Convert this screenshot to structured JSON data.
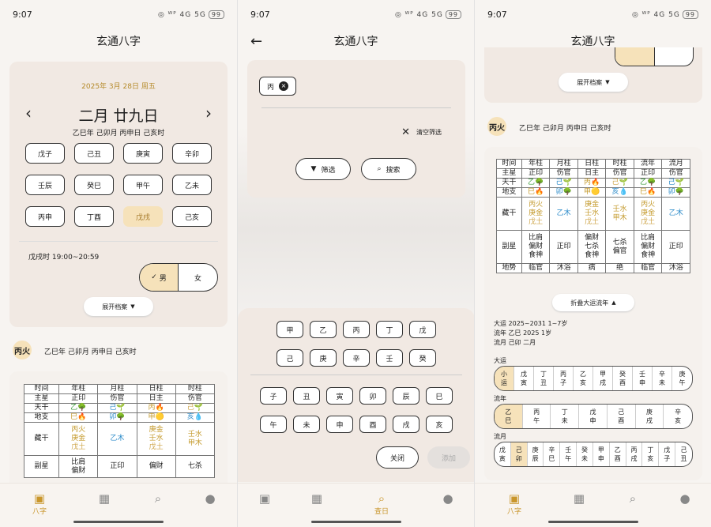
{
  "status": {
    "time": "9:07",
    "icons": "◎ ᵂᴾ 4G 5G",
    "battery": "99"
  },
  "app_title": "玄通八字",
  "p1": {
    "date_line": "2025年 3月 28日 周五",
    "lunar": "二月 廿九日",
    "ganzhi": "乙巳年 己卯月 丙申日 己亥时",
    "hours": [
      "戊子",
      "己丑",
      "庚寅",
      "辛卯",
      "壬辰",
      "癸巳",
      "甲午",
      "乙未",
      "丙申",
      "丁酉",
      "戊戌",
      "己亥"
    ],
    "hour_info": "戊戌时 19:00~20:59",
    "male": "男",
    "female": "女",
    "expand": "展开档案",
    "daymaster": "丙火",
    "ganzhi2": "乙巳年 己卯月 丙申日 己亥时",
    "tbl_head": [
      "时间",
      "年柱",
      "月柱",
      "日柱",
      "时柱"
    ],
    "zhuxing": [
      "主星",
      "正印",
      "伤官",
      "日主",
      "伤官"
    ],
    "tiangan_l": "天干",
    "tiangan": [
      "乙🌳",
      "己🌱",
      "丙🔥",
      "己🌱"
    ],
    "dizhi_l": "地支",
    "dizhi": [
      "巳🔥",
      "卯🌳",
      "申🟡",
      "亥💧"
    ],
    "canggan_l": "藏干",
    "cg_year": [
      "丙火",
      "庚金",
      "戊土"
    ],
    "cg_month": "乙木",
    "cg_day": [
      "庚金",
      "壬水",
      "戊土"
    ],
    "cg_hour": [
      "壬水",
      "甲木"
    ],
    "fuxing_l": "副星",
    "fx_year": [
      "比肩",
      "偏财"
    ],
    "fx_month": "正印",
    "fx_day": [
      "偏财"
    ],
    "fx_hour": "七杀"
  },
  "p2": {
    "chip": "丙",
    "clear": "清空筛选",
    "filter": "筛选",
    "search": "搜索",
    "stems": [
      "甲",
      "乙",
      "丙",
      "丁",
      "戊",
      "己",
      "庚",
      "辛",
      "壬",
      "癸"
    ],
    "branches": [
      "子",
      "丑",
      "寅",
      "卯",
      "辰",
      "巳",
      "午",
      "未",
      "申",
      "酉",
      "戌",
      "亥"
    ],
    "close": "关闭",
    "add": "添加"
  },
  "p3": {
    "expand": "展开档案",
    "daymaster": "丙火",
    "ganzhi": "乙巳年 己卯月 丙申日 己亥时",
    "head": [
      "时间",
      "年柱",
      "月柱",
      "日柱",
      "时柱",
      "流年",
      "流月"
    ],
    "zhuxing": [
      "主星",
      "正印",
      "伤官",
      "日主",
      "伤官",
      "正印",
      "伤官"
    ],
    "tiangan": [
      "天干",
      "乙🌳",
      "己🌱",
      "丙🔥",
      "己🌱",
      "乙🌳",
      "己🌱"
    ],
    "dizhi": [
      "地支",
      "巳🔥",
      "卯🌳",
      "申🟡",
      "亥💧",
      "巳🔥",
      "卯🌳"
    ],
    "canggan_l": "藏干",
    "cg_year": [
      "丙火",
      "庚金",
      "戊土"
    ],
    "cg_month": "乙木",
    "cg_day": [
      "庚金",
      "壬水",
      "戊土"
    ],
    "cg_hour": [
      "壬水",
      "甲木"
    ],
    "cg_ln": [
      "丙火",
      "庚金",
      "戊土"
    ],
    "cg_ly": "乙木",
    "fuxing_l": "副星",
    "fx_year": [
      "比肩",
      "偏财",
      "食神"
    ],
    "fx_month": "正印",
    "fx_day": [
      "偏财",
      "七杀",
      "食神"
    ],
    "fx_hour": [
      "七杀",
      "偏官"
    ],
    "fx_ln": [
      "比肩",
      "偏财",
      "食神"
    ],
    "fx_ly": "正印",
    "dishi": [
      "地势",
      "临官",
      "沐浴",
      "病",
      "绝",
      "临官",
      "沐浴"
    ],
    "collapse": "折叠大运流年",
    "dayun_line": "大运 2025~2031 1~7岁",
    "liunian_line": "流年 乙巳 2025 1岁",
    "liuyue_line": "流月 己卯 二月",
    "dy_label": "大运",
    "dayun": [
      [
        "小",
        "运"
      ],
      [
        "戊",
        "寅"
      ],
      [
        "丁",
        "丑"
      ],
      [
        "丙",
        "子"
      ],
      [
        "乙",
        "亥"
      ],
      [
        "甲",
        "戌"
      ],
      [
        "癸",
        "酉"
      ],
      [
        "壬",
        "申"
      ],
      [
        "辛",
        "未"
      ],
      [
        "庚",
        "午"
      ]
    ],
    "ln_label": "流年",
    "liunian": [
      [
        "乙",
        "巳"
      ],
      [
        "丙",
        "午"
      ],
      [
        "丁",
        "未"
      ],
      [
        "戊",
        "申"
      ],
      [
        "己",
        "酉"
      ],
      [
        "庚",
        "戌"
      ],
      [
        "辛",
        "亥"
      ]
    ],
    "ly_label": "流月",
    "liuyue": [
      [
        "戊",
        "寅"
      ],
      [
        "己",
        "卯"
      ],
      [
        "庚",
        "辰"
      ],
      [
        "辛",
        "巳"
      ],
      [
        "壬",
        "午"
      ],
      [
        "癸",
        "未"
      ],
      [
        "甲",
        "申"
      ],
      [
        "乙",
        "酉"
      ],
      [
        "丙",
        "戌"
      ],
      [
        "丁",
        "亥"
      ],
      [
        "戊",
        "子"
      ],
      [
        "己",
        "丑"
      ]
    ]
  },
  "tabs": [
    {
      "label": "八字"
    },
    {
      "label": ""
    },
    {
      "label": "查日"
    },
    {
      "label": ""
    }
  ]
}
